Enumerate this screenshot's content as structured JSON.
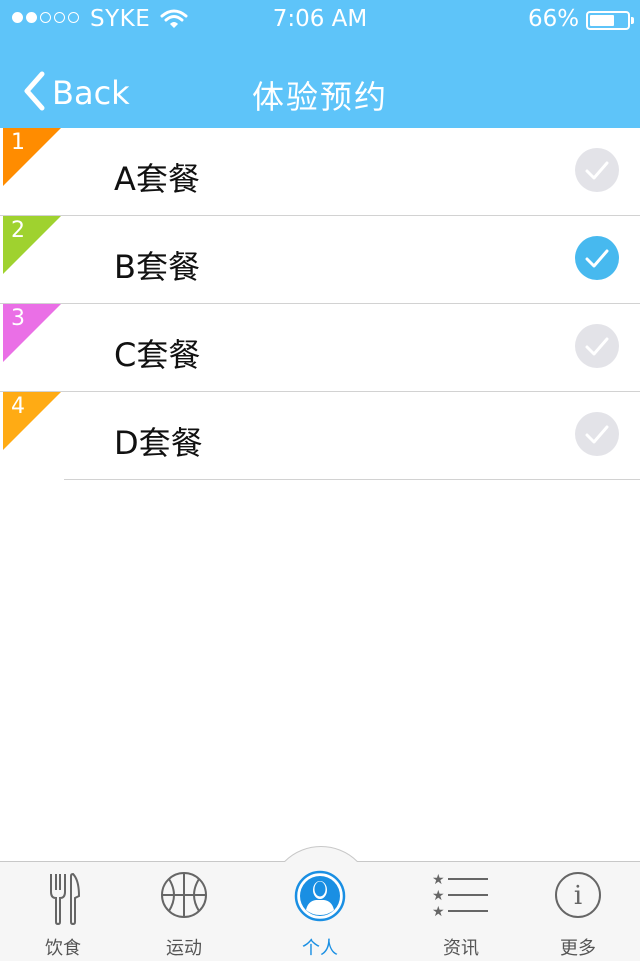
{
  "status_bar": {
    "carrier": "SYKE",
    "time": "7:06 AM",
    "battery_percent": "66%",
    "battery_level": 0.66,
    "signal_bars": 2,
    "signal_total": 5
  },
  "nav": {
    "back_label": "Back",
    "title": "体验预约"
  },
  "colors": {
    "nav_bg": "#5ec4f9",
    "check_on": "#47b9ef",
    "check_off": "#e3e3e8",
    "tab_active": "#1a8fe3"
  },
  "packages": [
    {
      "number": "1",
      "label": "A套餐",
      "ribbon_color": "#ff8c00",
      "selected": false
    },
    {
      "number": "2",
      "label": "B套餐",
      "ribbon_color": "#9fd22f",
      "selected": true
    },
    {
      "number": "3",
      "label": "C套餐",
      "ribbon_color": "#ea6fe6",
      "selected": false
    },
    {
      "number": "4",
      "label": "D套餐",
      "ribbon_color": "#ffab14",
      "selected": false
    }
  ],
  "tabs": [
    {
      "label": "饮食",
      "icon": "fork-knife-icon",
      "active": false
    },
    {
      "label": "运动",
      "icon": "basketball-icon",
      "active": false
    },
    {
      "label": "个人",
      "icon": "person-icon",
      "active": true
    },
    {
      "label": "资讯",
      "icon": "star-list-icon",
      "active": false
    },
    {
      "label": "更多",
      "icon": "info-icon",
      "active": false
    }
  ]
}
